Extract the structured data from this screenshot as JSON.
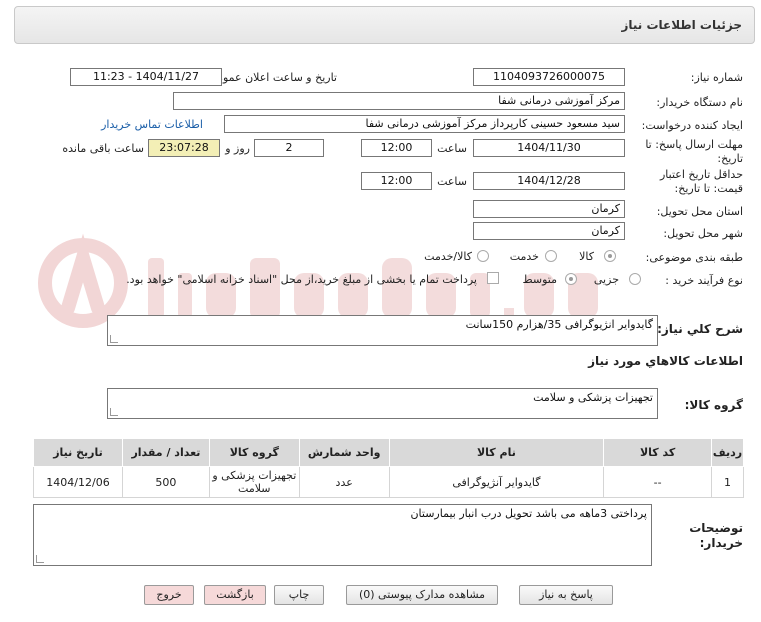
{
  "header": {
    "title": "جزئیات اطلاعات نیاز"
  },
  "fields": {
    "need_number_label": "شماره نیاز:",
    "need_number": "1104093726000075",
    "announce_label": "تاریخ و ساعت اعلان عمومی:",
    "announce_value": "1404/11/27 - 11:23",
    "buyer_label": "نام دستگاه خریدار:",
    "buyer_value": "مرکز آموزشی درمانی شفا",
    "creator_label": "ایجاد کننده درخواست:",
    "creator_value": "سید مسعود حسینی کارپرداز مرکز آموزشی درمانی شفا",
    "contact_link": "اطلاعات تماس خریدار",
    "deadline_label_1": "مهلت ارسال پاسخ: تا",
    "deadline_label_2": "تاریخ:",
    "deadline_date": "1404/11/30",
    "time_label": "ساعت",
    "deadline_time": "12:00",
    "days_value": "2",
    "days_label": "روز و",
    "remaining_time": "23:07:28",
    "remaining_label": "ساعت باقی مانده",
    "validity_label_1": "حداقل تاریخ اعتبار",
    "validity_label_2": "قیمت: تا تاریخ:",
    "validity_date": "1404/12/28",
    "validity_time": "12:00",
    "province_label": "استان محل تحویل:",
    "province_value": "کرمان",
    "city_label": "شهر محل تحویل:",
    "city_value": "کرمان",
    "category_label": "طبقه بندی موضوعی:",
    "category_options": [
      "کالا",
      "خدمت",
      "کالا/خدمت"
    ],
    "process_label": "نوع فرآیند خرید :",
    "process_options": [
      "جزیی",
      "متوسط"
    ],
    "payment_note": "پرداخت تمام یا بخشی از مبلغ خرید،از محل \"اسناد خزانه اسلامی\" خواهد بود."
  },
  "description": {
    "label": "شرح کلي نياز:",
    "value": "گایدوایر انژیوگرافی 35/هزارم 150سانت"
  },
  "goods_info": {
    "title": "اطلاعات کالاهاي مورد نياز"
  },
  "goods_group": {
    "label": "گروه کالا:",
    "value": "تجهیزات پزشکی و سلامت"
  },
  "table": {
    "headers": [
      "رديف",
      "کد کالا",
      "نام کالا",
      "واحد شمارش",
      "گروه کالا",
      "تعداد / مقدار",
      "تاريخ نياز"
    ],
    "rows": [
      [
        "1",
        "--",
        "گایدوایر آنژیوگرافی",
        "عدد",
        "تجهیزات پزشکی و سلامت",
        "500",
        "1404/12/06"
      ]
    ]
  },
  "buyer_notes": {
    "label_1": "توضیحات",
    "label_2": "خریدار:",
    "value": "پرداختی 3ماهه می باشد تحویل درب انبار بیمارستان"
  },
  "buttons": {
    "reply": "پاسخ به نیاز",
    "docs": "مشاهده مدارک پیوستی (0)",
    "print": "چاپ",
    "back": "بازگشت",
    "exit": "خروج"
  },
  "colors": {
    "link": "#1a5ea8",
    "highlight": "#f3efb6",
    "table_header": "#d9d9d9"
  }
}
